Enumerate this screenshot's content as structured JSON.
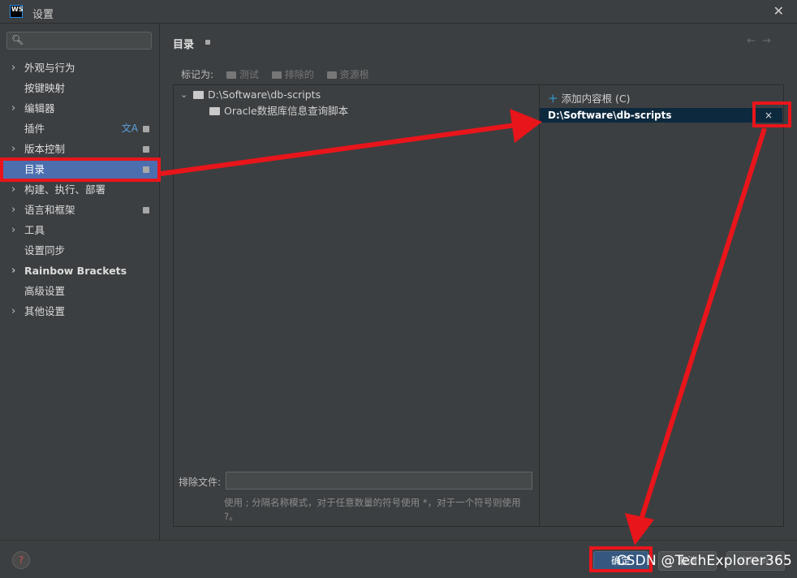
{
  "window": {
    "logo": "WS",
    "title": "设置",
    "close": "✕"
  },
  "sidebar": {
    "search_placeholder": "",
    "items": [
      {
        "label": "外观与行为",
        "expandable": true
      },
      {
        "label": "按键映射",
        "expandable": false
      },
      {
        "label": "编辑器",
        "expandable": true
      },
      {
        "label": "插件",
        "expandable": false,
        "translate_icon": "文A"
      },
      {
        "label": "版本控制",
        "expandable": true
      },
      {
        "label": "目录",
        "expandable": false,
        "selected": true
      },
      {
        "label": "构建、执行、部署",
        "expandable": true
      },
      {
        "label": "语言和框架",
        "expandable": true
      },
      {
        "label": "工具",
        "expandable": true
      },
      {
        "label": "设置同步",
        "expandable": false
      },
      {
        "label": "Rainbow Brackets",
        "expandable": true
      },
      {
        "label": "高级设置",
        "expandable": false
      },
      {
        "label": "其他设置",
        "expandable": true
      }
    ]
  },
  "main": {
    "title": "目录",
    "nav_back": "←",
    "nav_forward": "→",
    "mark_as": {
      "label": "标记为:",
      "options": [
        "测试",
        "排除的",
        "资源根"
      ]
    },
    "tree": {
      "root": "D:\\Software\\db-scripts",
      "child": "Oracle数据库信息查询脚本"
    },
    "exclude": {
      "label": "排除文件:",
      "value": "",
      "hint": "使用 ; 分隔名称模式，对于任意数量的符号使用 *，对于一个符号则使用 ?。"
    },
    "roots": {
      "add_label": "添加内容根 (C)",
      "items": [
        "D:\\Software\\db-scripts"
      ],
      "remove": "×"
    }
  },
  "footer": {
    "help": "?",
    "ok": "确定",
    "cancel": "取消",
    "apply": "应用(A)"
  },
  "watermark": "CSDN @TechExplorer365",
  "annotation_color": "#e8151b"
}
